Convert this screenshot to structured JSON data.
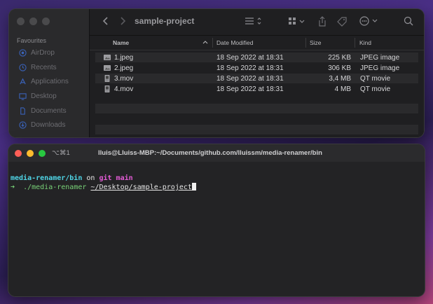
{
  "finder": {
    "title": "sample-project",
    "sidebar": {
      "header": "Favourites",
      "items": [
        {
          "label": "AirDrop",
          "icon": "airdrop-icon"
        },
        {
          "label": "Recents",
          "icon": "clock-icon"
        },
        {
          "label": "Applications",
          "icon": "applications-icon"
        },
        {
          "label": "Desktop",
          "icon": "desktop-icon"
        },
        {
          "label": "Documents",
          "icon": "document-icon"
        },
        {
          "label": "Downloads",
          "icon": "download-icon"
        }
      ]
    },
    "columns": {
      "name": "Name",
      "date": "Date Modified",
      "size": "Size",
      "kind": "Kind"
    },
    "rows": [
      {
        "name": "1.jpeg",
        "date": "18 Sep 2022 at 18:31",
        "size": "225 KB",
        "kind": "JPEG image",
        "icon": "image-file-icon"
      },
      {
        "name": "2.jpeg",
        "date": "18 Sep 2022 at 18:31",
        "size": "306 KB",
        "kind": "JPEG image",
        "icon": "image-file-icon"
      },
      {
        "name": "3.mov",
        "date": "18 Sep 2022 at 18:31",
        "size": "3,4 MB",
        "kind": "QT movie",
        "icon": "movie-file-icon"
      },
      {
        "name": "4.mov",
        "date": "18 Sep 2022 at 18:31",
        "size": "4 MB",
        "kind": "QT movie",
        "icon": "movie-file-icon"
      }
    ]
  },
  "terminal": {
    "tab_label": "⌥⌘1",
    "title": "lluis@Lluiss-MBP:~/Documents/github.com/lluissm/media-renamer/bin",
    "line1": {
      "dir": "media-renamer/bin",
      "on": " on ",
      "git_label": "git",
      "branch": "main"
    },
    "line2": {
      "prompt": "➜",
      "command": "./media-renamer",
      "arg": "~/Desktop/sample-project"
    }
  },
  "colors": {
    "finder_bg": "#1f1f21",
    "terminal_bg": "#232325",
    "close": "#ff5f57",
    "minimize": "#febc2e",
    "maximize": "#28c840",
    "cyan": "#4fd5e6",
    "magenta": "#e25bd4",
    "green": "#78d278"
  }
}
